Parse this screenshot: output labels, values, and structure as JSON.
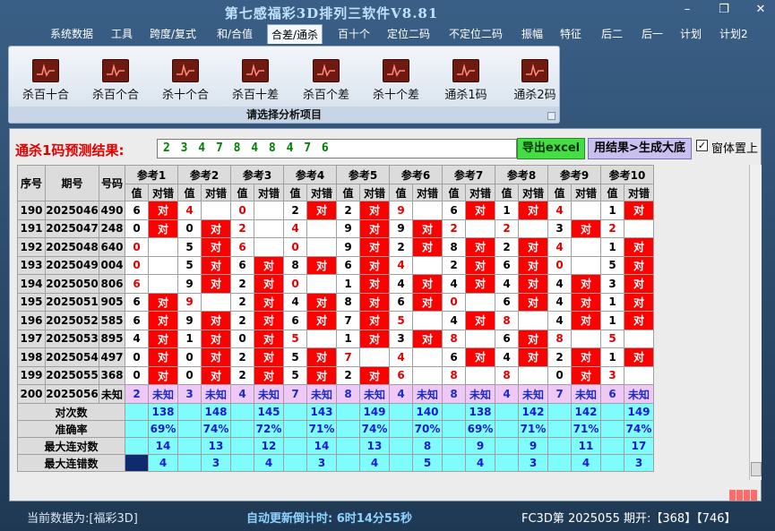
{
  "window": {
    "title": "第七感福彩3D排列三软件V8.81"
  },
  "menu": [
    "系统数据",
    "工具",
    "跨度/复式",
    "和/合值",
    "合差/通杀",
    "百十个",
    "定位二码",
    "不定位二码",
    "振幅",
    "特征",
    "后二",
    "后一",
    "计划",
    "计划2"
  ],
  "ribbon": {
    "buttons": [
      "杀百十合",
      "杀百个合",
      "杀十个合",
      "杀百十差",
      "杀百个差",
      "杀十个差",
      "通杀1码",
      "通杀2码"
    ],
    "group_label": "请选择分析项目"
  },
  "prediction": {
    "label": "通杀1码预测结果:",
    "value": "2 3 4 7 8 4 8 4 7 6",
    "export_button": "导出excel",
    "generate_button": "用结果>生成大底",
    "topmost_label": "窗体置上",
    "topmost_checked": true
  },
  "table": {
    "headers": {
      "seq": "序号",
      "issue": "期号",
      "code": "号码",
      "ref_prefix": "参考",
      "value": "值",
      "hit": "对错"
    },
    "hit_text": "对",
    "rows": [
      {
        "seq": "190",
        "issue": "2025046",
        "code": "490",
        "cells": [
          [
            "6",
            true,
            false
          ],
          [
            "4",
            false,
            true
          ],
          [
            "0",
            false,
            true
          ],
          [
            "2",
            true,
            false
          ],
          [
            "2",
            true,
            false
          ],
          [
            "9",
            false,
            true
          ],
          [
            "6",
            true,
            false
          ],
          [
            "1",
            true,
            false
          ],
          [
            "4",
            false,
            true
          ],
          [
            "1",
            true,
            false
          ]
        ]
      },
      {
        "seq": "191",
        "issue": "2025047",
        "code": "248",
        "cells": [
          [
            "0",
            true,
            false
          ],
          [
            "0",
            true,
            false
          ],
          [
            "2",
            false,
            true
          ],
          [
            "4",
            false,
            true
          ],
          [
            "9",
            true,
            false
          ],
          [
            "9",
            true,
            false
          ],
          [
            "2",
            false,
            true
          ],
          [
            "2",
            false,
            true
          ],
          [
            "3",
            true,
            false
          ],
          [
            "2",
            false,
            true
          ]
        ]
      },
      {
        "seq": "192",
        "issue": "2025048",
        "code": "640",
        "cells": [
          [
            "0",
            false,
            true
          ],
          [
            "5",
            true,
            false
          ],
          [
            "6",
            false,
            true
          ],
          [
            "0",
            false,
            true
          ],
          [
            "9",
            true,
            false
          ],
          [
            "2",
            true,
            false
          ],
          [
            "8",
            true,
            false
          ],
          [
            "2",
            true,
            false
          ],
          [
            "4",
            false,
            true
          ],
          [
            "1",
            true,
            false
          ]
        ]
      },
      {
        "seq": "193",
        "issue": "2025049",
        "code": "004",
        "cells": [
          [
            "0",
            false,
            true
          ],
          [
            "5",
            true,
            false
          ],
          [
            "6",
            true,
            false
          ],
          [
            "8",
            true,
            false
          ],
          [
            "6",
            true,
            false
          ],
          [
            "4",
            false,
            true
          ],
          [
            "2",
            true,
            false
          ],
          [
            "6",
            true,
            false
          ],
          [
            "0",
            false,
            true
          ],
          [
            "5",
            true,
            false
          ]
        ]
      },
      {
        "seq": "194",
        "issue": "2025050",
        "code": "806",
        "cells": [
          [
            "6",
            false,
            true
          ],
          [
            "9",
            true,
            false
          ],
          [
            "2",
            true,
            false
          ],
          [
            "0",
            false,
            true
          ],
          [
            "1",
            true,
            false
          ],
          [
            "4",
            true,
            false
          ],
          [
            "4",
            true,
            false
          ],
          [
            "4",
            true,
            false
          ],
          [
            "4",
            true,
            false
          ],
          [
            "3",
            true,
            false
          ]
        ]
      },
      {
        "seq": "195",
        "issue": "2025051",
        "code": "905",
        "cells": [
          [
            "6",
            true,
            false
          ],
          [
            "9",
            false,
            true
          ],
          [
            "2",
            true,
            false
          ],
          [
            "4",
            true,
            false
          ],
          [
            "8",
            true,
            false
          ],
          [
            "6",
            true,
            false
          ],
          [
            "0",
            false,
            true
          ],
          [
            "6",
            true,
            false
          ],
          [
            "4",
            true,
            false
          ],
          [
            "1",
            true,
            false
          ]
        ]
      },
      {
        "seq": "196",
        "issue": "2025052",
        "code": "585",
        "cells": [
          [
            "6",
            true,
            false
          ],
          [
            "9",
            true,
            false
          ],
          [
            "2",
            true,
            false
          ],
          [
            "6",
            true,
            false
          ],
          [
            "7",
            true,
            false
          ],
          [
            "5",
            false,
            true
          ],
          [
            "4",
            true,
            false
          ],
          [
            "8",
            false,
            true
          ],
          [
            "4",
            true,
            false
          ],
          [
            "1",
            true,
            false
          ]
        ]
      },
      {
        "seq": "197",
        "issue": "2025053",
        "code": "895",
        "cells": [
          [
            "4",
            true,
            false
          ],
          [
            "1",
            true,
            false
          ],
          [
            "0",
            true,
            false
          ],
          [
            "5",
            false,
            true
          ],
          [
            "1",
            true,
            false
          ],
          [
            "3",
            true,
            false
          ],
          [
            "8",
            false,
            true
          ],
          [
            "6",
            true,
            false
          ],
          [
            "8",
            false,
            true
          ],
          [
            "5",
            false,
            true
          ]
        ]
      },
      {
        "seq": "198",
        "issue": "2025054",
        "code": "497",
        "cells": [
          [
            "0",
            true,
            false
          ],
          [
            "0",
            true,
            false
          ],
          [
            "2",
            true,
            false
          ],
          [
            "5",
            true,
            false
          ],
          [
            "7",
            false,
            true
          ],
          [
            "4",
            false,
            true
          ],
          [
            "6",
            true,
            false
          ],
          [
            "4",
            true,
            false
          ],
          [
            "2",
            true,
            false
          ],
          [
            "1",
            true,
            false
          ]
        ]
      },
      {
        "seq": "199",
        "issue": "2025055",
        "code": "368",
        "cells": [
          [
            "0",
            true,
            false
          ],
          [
            "0",
            true,
            false
          ],
          [
            "2",
            true,
            false
          ],
          [
            "5",
            true,
            false
          ],
          [
            "2",
            true,
            false
          ],
          [
            "6",
            false,
            true
          ],
          [
            "8",
            false,
            true
          ],
          [
            "8",
            false,
            true
          ],
          [
            "0",
            true,
            false
          ],
          [
            "3",
            false,
            true
          ]
        ]
      }
    ],
    "pending": {
      "seq": "200",
      "issue": "2025056",
      "code": "未知",
      "values": [
        "2",
        "3",
        "4",
        "7",
        "8",
        "4",
        "8",
        "4",
        "7",
        "6"
      ],
      "status": "未知"
    },
    "stats": [
      {
        "label": "对次数",
        "values": [
          "138",
          "148",
          "145",
          "143",
          "149",
          "140",
          "138",
          "142",
          "142",
          "149"
        ]
      },
      {
        "label": "准确率",
        "values": [
          "69%",
          "74%",
          "72%",
          "71%",
          "74%",
          "70%",
          "69%",
          "71%",
          "71%",
          "74%"
        ]
      },
      {
        "label": "最大连对数",
        "values": [
          "14",
          "13",
          "12",
          "14",
          "13",
          "8",
          "9",
          "9",
          "11",
          "17"
        ]
      },
      {
        "label": "最大连错数",
        "values": [
          "4",
          "3",
          "4",
          "3",
          "4",
          "5",
          "4",
          "3",
          "4",
          "3"
        ]
      }
    ]
  },
  "status": {
    "data_source": "当前数据为:[福彩3D]",
    "countdown": "自动更新倒计时: 6时14分55秒",
    "latest": "FC3D第 2025055 期开:【368】【746】"
  },
  "colors": {
    "hit": "#ff0000",
    "miss_value": "#e00000",
    "pending_bg": "#f0c8f7",
    "stat_bg": "#7ffcfc",
    "title": "#bfe0ff"
  }
}
